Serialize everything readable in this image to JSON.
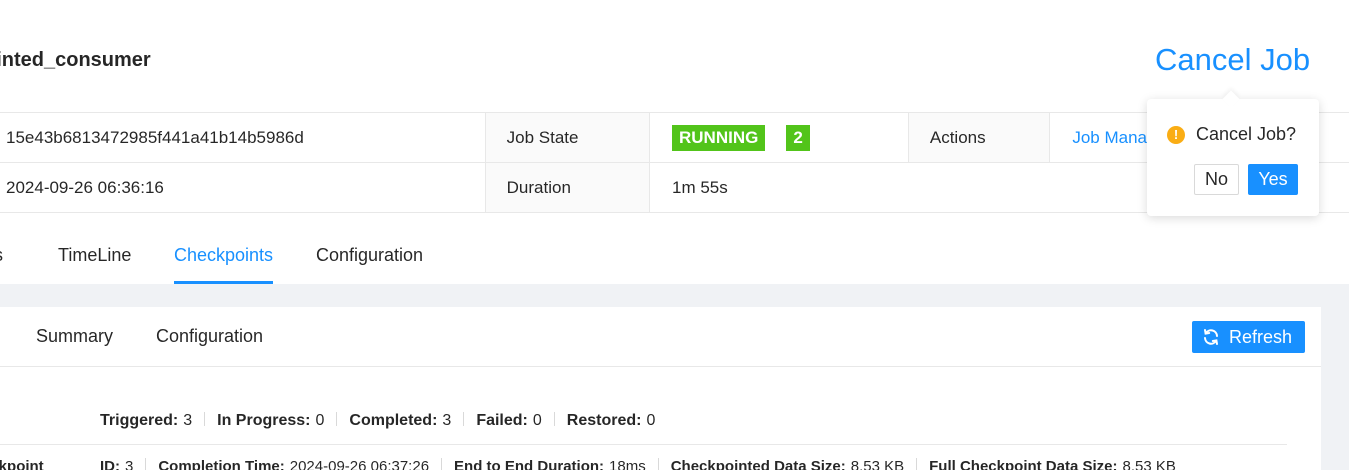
{
  "header": {
    "job_name": "ointed_consumer",
    "cancel_job_label": "Cancel Job"
  },
  "details": {
    "job_id": "15e43b6813472985f441a41b14b5986d",
    "start_time": "2024-09-26 06:36:16",
    "job_state_label": "Job State",
    "job_state_value": "RUNNING",
    "job_state_count": "2",
    "duration_label": "Duration",
    "duration_value": "1m 55s",
    "actions_label": "Actions",
    "actions_link": "Job Manager"
  },
  "tabs": [
    "ns",
    "TimeLine",
    "Checkpoints",
    "Configuration"
  ],
  "active_tab": "Checkpoints",
  "subtabs": [
    "Summary",
    "Configuration"
  ],
  "refresh_label": "Refresh",
  "counts": [
    {
      "label": "Triggered:",
      "value": "3"
    },
    {
      "label": "In Progress:",
      "value": "0"
    },
    {
      "label": "Completed:",
      "value": "3"
    },
    {
      "label": "Failed:",
      "value": "0"
    },
    {
      "label": "Restored:",
      "value": "0"
    }
  ],
  "latest_checkpoint": {
    "label": "eckpoint",
    "items": [
      {
        "label": "ID:",
        "value": "3"
      },
      {
        "label": "Completion Time:",
        "value": "2024-09-26 06:37:26"
      },
      {
        "label": "End to End Duration:",
        "value": "18ms"
      },
      {
        "label": "Checkpointed Data Size:",
        "value": "8.53 KB"
      },
      {
        "label": "Full Checkpoint Data Size:",
        "value": "8.53 KB"
      }
    ]
  },
  "popover": {
    "title": "Cancel Job?",
    "warning_glyph": "!",
    "no_label": "No",
    "yes_label": "Yes"
  },
  "colors": {
    "accent": "#1890ff",
    "running": "#52c41a",
    "warning": "#faad14"
  }
}
